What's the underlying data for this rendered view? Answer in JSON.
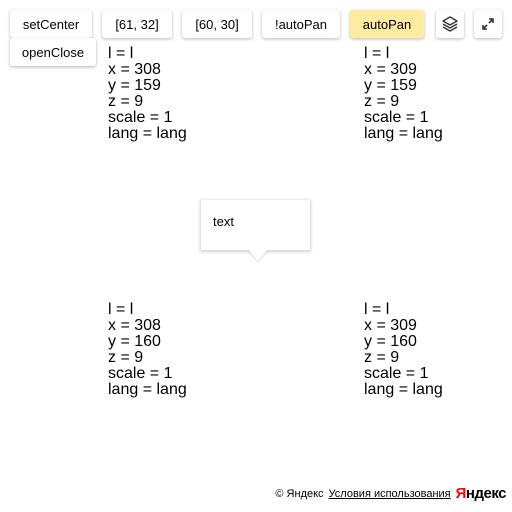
{
  "controls": {
    "set_center": "setCenter",
    "coord_61_32": "[61, 32]",
    "coord_60_30": "[60, 30]",
    "not_autopan": "!autoPan",
    "autopan": "autoPan",
    "open_close": "openClose",
    "layers_icon": "layers-icon",
    "fullscreen_icon": "expand-icon",
    "selected_color": "#ffeba0"
  },
  "tiles": [
    {
      "l": "l = l",
      "x": "x = 308",
      "y": "y = 159",
      "z": "z = 9",
      "scale": "scale = 1",
      "lang": "lang = lang"
    },
    {
      "l": "l = l",
      "x": "x = 309",
      "y": "y = 159",
      "z": "z = 9",
      "scale": "scale = 1",
      "lang": "lang = lang"
    },
    {
      "l": "l = l",
      "x": "x = 308",
      "y": "y = 160",
      "z": "z = 9",
      "scale": "scale = 1",
      "lang": "lang = lang"
    },
    {
      "l": "l = l",
      "x": "x = 309",
      "y": "y = 160",
      "z": "z = 9",
      "scale": "scale = 1",
      "lang": "lang = lang"
    }
  ],
  "balloon": {
    "content": "text"
  },
  "copyrights": {
    "copyright": "© Яндекс",
    "terms": "Условия использования",
    "logo_first": "Я",
    "logo_rest": "ндекс",
    "logo_color": "#ff0000"
  }
}
